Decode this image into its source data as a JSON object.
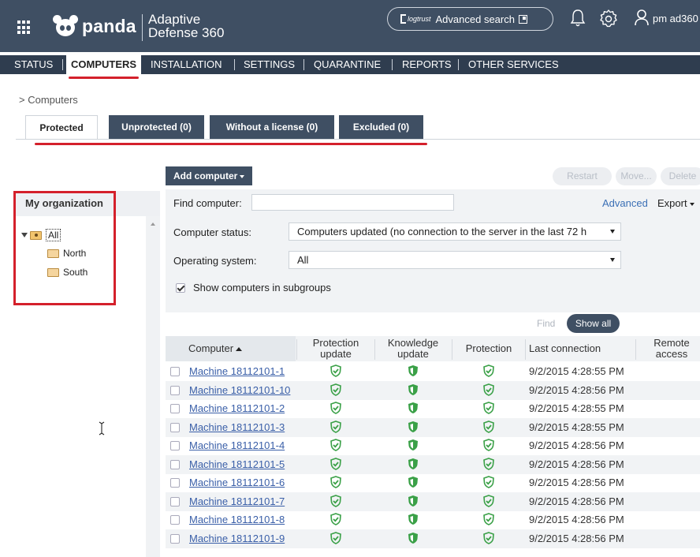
{
  "header": {
    "brand": "panda",
    "product_line1": "Adaptive",
    "product_line2": "Defense 360",
    "logtrust": "logtrust",
    "search_label": "Advanced search",
    "username": "pm ad360"
  },
  "nav": {
    "items": [
      "STATUS",
      "COMPUTERS",
      "INSTALLATION",
      "SETTINGS",
      "QUARANTINE",
      "REPORTS",
      "OTHER SERVICES"
    ],
    "active": "COMPUTERS"
  },
  "breadcrumb": "> Computers",
  "tabs": [
    {
      "label": "Protected",
      "active": true
    },
    {
      "label": "Unprotected (0)",
      "active": false
    },
    {
      "label": "Without a license (0)",
      "active": false
    },
    {
      "label": "Excluded (0)",
      "active": false
    }
  ],
  "sidebar": {
    "title": "My organization",
    "tree": [
      {
        "label": "All",
        "selected": true
      },
      {
        "label": "North"
      },
      {
        "label": "South"
      }
    ]
  },
  "toolbar": {
    "add_computer": "Add computer",
    "restart": "Restart",
    "move": "Move...",
    "delete": "Delete"
  },
  "filters": {
    "find_label": "Find computer:",
    "find_value": "",
    "advanced": "Advanced",
    "export": "Export",
    "status_label": "Computer status:",
    "status_value": "Computers updated (no connection to the server in the last 72 h",
    "os_label": "Operating system:",
    "os_value": "All",
    "subgroups_label": "Show computers in subgroups",
    "subgroups_checked": true,
    "find_button": "Find",
    "show_all": "Show all"
  },
  "table": {
    "columns": [
      "Computer",
      "Protection update",
      "Knowledge update",
      "Protection",
      "Last connection",
      "Remote access"
    ],
    "rows": [
      {
        "name": "Machine 18112101-1",
        "last": "9/2/2015 4:28:55 PM"
      },
      {
        "name": "Machine 18112101-10",
        "last": "9/2/2015 4:28:56 PM"
      },
      {
        "name": "Machine 18112101-2",
        "last": "9/2/2015 4:28:55 PM"
      },
      {
        "name": "Machine 18112101-3",
        "last": "9/2/2015 4:28:55 PM"
      },
      {
        "name": "Machine 18112101-4",
        "last": "9/2/2015 4:28:56 PM"
      },
      {
        "name": "Machine 18112101-5",
        "last": "9/2/2015 4:28:56 PM"
      },
      {
        "name": "Machine 18112101-6",
        "last": "9/2/2015 4:28:56 PM"
      },
      {
        "name": "Machine 18112101-7",
        "last": "9/2/2015 4:28:56 PM"
      },
      {
        "name": "Machine 18112101-8",
        "last": "9/2/2015 4:28:56 PM"
      },
      {
        "name": "Machine 18112101-9",
        "last": "9/2/2015 4:28:56 PM"
      }
    ]
  },
  "colors": {
    "header_bg": "#3f4f63",
    "nav_bg": "#2f3d4f",
    "annotation_red": "#d4202b",
    "status_green": "#3aa047",
    "link_blue": "#3a5fa8"
  },
  "icons": {
    "protection_update": "shield-check-icon",
    "knowledge_update": "shield-half-icon",
    "protection": "shield-check-icon"
  }
}
